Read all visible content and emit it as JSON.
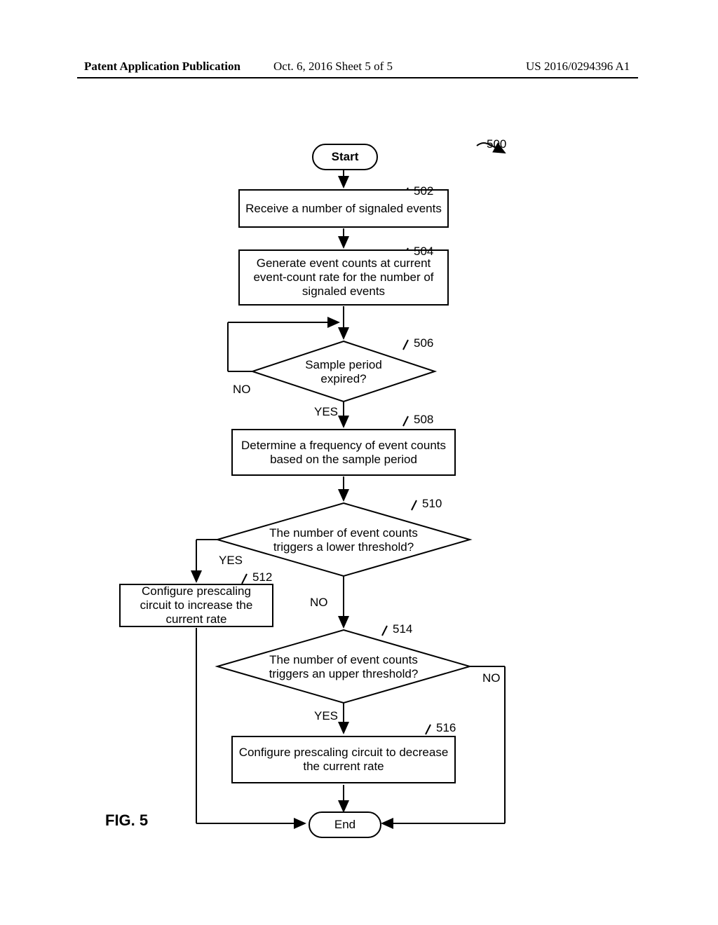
{
  "header": {
    "left": "Patent Application Publication",
    "center": "Oct. 6, 2016  Sheet 5 of 5",
    "right": "US 2016/0294396 A1"
  },
  "terminals": {
    "start": "Start",
    "end": "End"
  },
  "boxes": {
    "b502": "Receive a number of signaled events",
    "b504": "Generate event counts at current event-count rate for the number of signaled events",
    "b508": "Determine a frequency of event counts based on the sample period",
    "b512": "Configure prescaling circuit to increase the current rate",
    "b516": "Configure prescaling circuit to decrease the current rate"
  },
  "diamonds": {
    "d506": "Sample period expired?",
    "d510": "The number of event counts triggers a lower threshold?",
    "d514": "The number of event counts triggers an upper threshold?"
  },
  "labels": {
    "no": "NO",
    "yes": "YES"
  },
  "refs": {
    "r500": "500",
    "r502": "502",
    "r504": "504",
    "r506": "506",
    "r508": "508",
    "r510": "510",
    "r512": "512",
    "r514": "514",
    "r516": "516"
  },
  "figure": "FIG. 5"
}
